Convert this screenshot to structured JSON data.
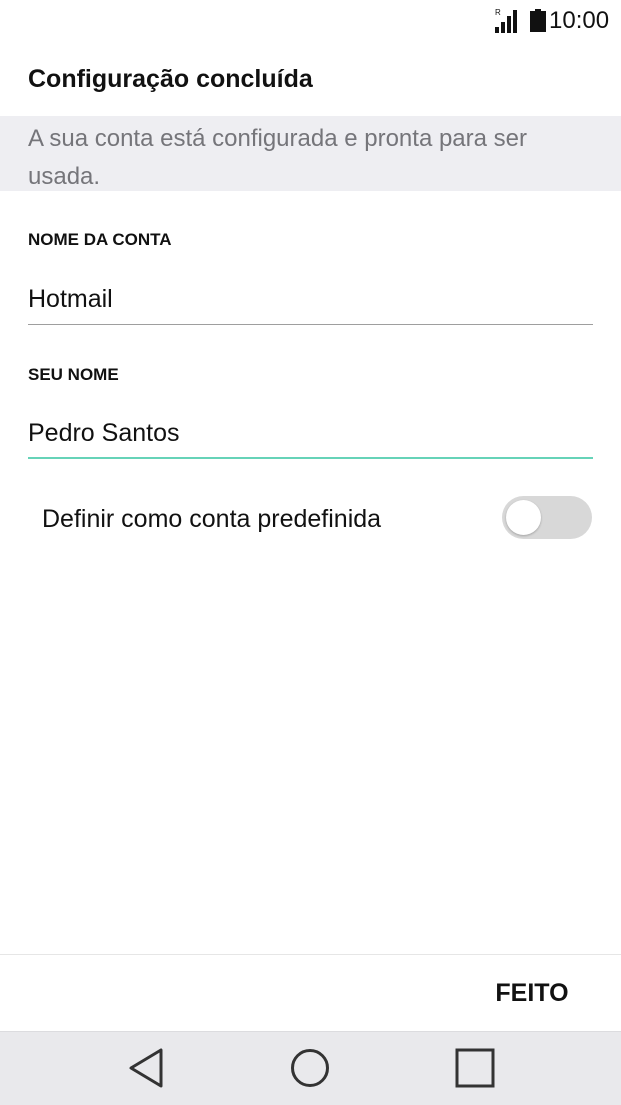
{
  "status_bar": {
    "roaming_indicator": "R",
    "time": "10:00",
    "icons": [
      "signal-icon",
      "battery-icon"
    ]
  },
  "header": {
    "title": "Configuração concluída"
  },
  "description": "A sua conta está configurada e pronta para ser usada.",
  "form": {
    "account_name": {
      "label": "NOME DA CONTA",
      "value": "Hotmail"
    },
    "your_name": {
      "label": "SEU NOME",
      "value": "Pedro Santos"
    },
    "default_account": {
      "label": "Definir como conta predefinida",
      "enabled": false
    }
  },
  "footer": {
    "done_label": "FEITO"
  },
  "nav_bar": {
    "icons": [
      "back-icon",
      "home-icon",
      "recents-icon"
    ]
  },
  "colors": {
    "focus_underline": "#66d3b8",
    "description_background": "#eeeef2",
    "description_text": "#75757a",
    "toggle_track_off": "#d8d8d8"
  }
}
